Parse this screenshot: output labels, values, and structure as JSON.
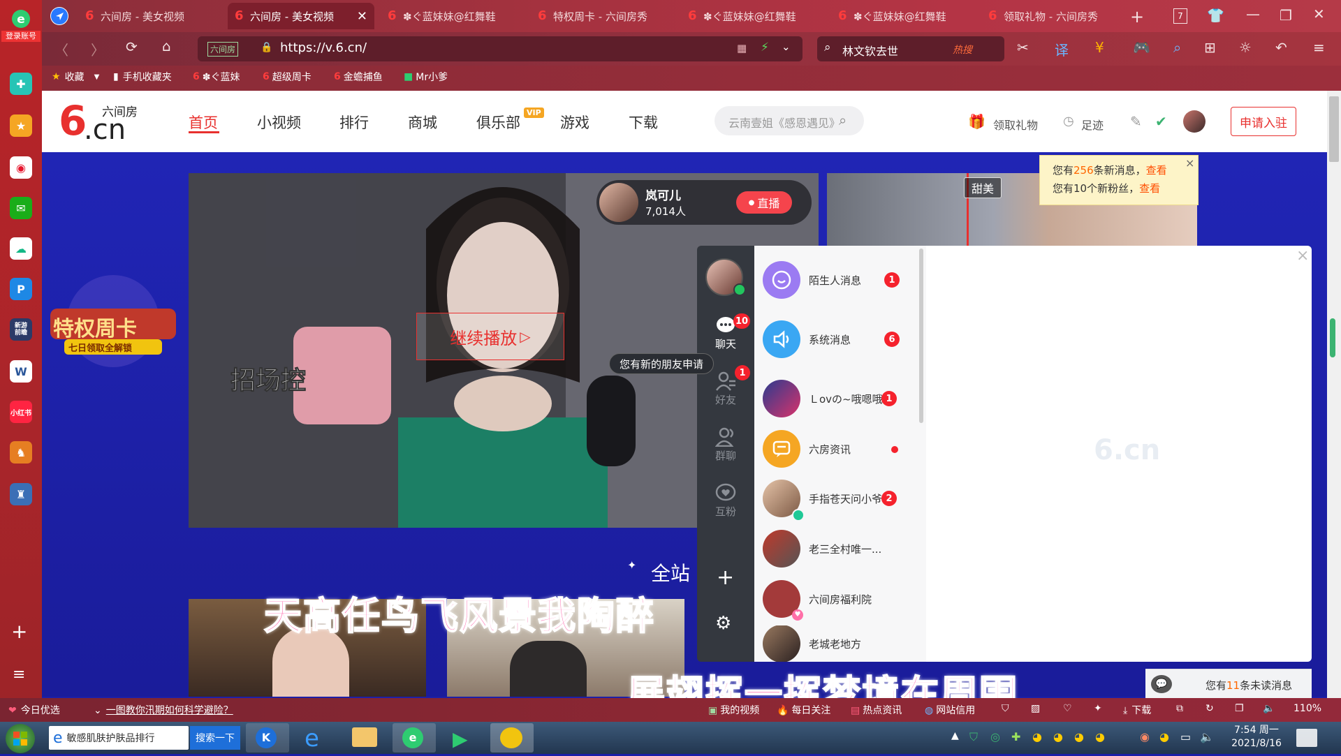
{
  "left_rail": {
    "login_label": "登录账号",
    "icons": [
      "green-plus-icon",
      "star-favorites-icon",
      "weibo-icon",
      "mail-icon",
      "cloud-icon",
      "p-icon",
      "game-news-icon",
      "word-doc-icon",
      "xiaohongshu-icon",
      "game-icon",
      "game2-icon"
    ],
    "xhs_label": "小红书",
    "news_label": "新游\n前瞻",
    "add_symbol": "+",
    "menu_symbol": "≡"
  },
  "tabs": [
    {
      "label": "六间房 - 美女视频",
      "active": false
    },
    {
      "label": "六间房 - 美女视频",
      "active": true
    },
    {
      "label": "✽ぐ蓝妹妹@红舞鞋",
      "active": false
    },
    {
      "label": "特权周卡 - 六间房秀",
      "active": false
    },
    {
      "label": "✽ぐ蓝妹妹@红舞鞋",
      "active": false
    },
    {
      "label": "✽ぐ蓝妹妹@红舞鞋",
      "active": false
    },
    {
      "label": "领取礼物 - 六间房秀",
      "active": false
    }
  ],
  "tab_count": "7",
  "address": {
    "url": "https://v.6.cn/",
    "site_tag": "六间房",
    "search_text": "林文钦去世",
    "hot_label": "热搜"
  },
  "bookmarks": [
    "收藏",
    "手机收藏夹",
    "✽ぐ蓝妹",
    "超级周卡",
    "金蟾捕鱼",
    "Mr小爹"
  ],
  "site": {
    "logo_text": ".cn",
    "logo_six": "6",
    "logo_sub": "六间房",
    "nav": [
      "首页",
      "小视频",
      "排行",
      "商城",
      "俱乐部",
      "游戏",
      "下载"
    ],
    "vip_badge": "VIP",
    "search_placeholder": "云南壹姐《感恩遇见》",
    "gift_label": "领取礼物",
    "footprint_label": "足迹",
    "apply_label": "申请入驻"
  },
  "notification": {
    "line1_prefix": "您有",
    "line1_num": "256",
    "line1_suffix": "条新消息，",
    "line1_link": "查看",
    "line2_prefix": "您有10个新粉丝，",
    "line2_link": "查看"
  },
  "stream": {
    "host_name": "岚可儿",
    "viewers": "7,014人",
    "live_label": "直播",
    "overlay_text": "招场控",
    "continue_label": "继续播放",
    "tag_label": "甜美",
    "banner_title": "特权周卡",
    "banner_sub": "七日领取全解锁",
    "section_title": "全站"
  },
  "message_panel": {
    "rail": [
      {
        "label": "聊天",
        "badge": "10",
        "active": true
      },
      {
        "label": "好友",
        "badge": "1",
        "active": false
      },
      {
        "label": "群聊",
        "badge": "",
        "active": false
      },
      {
        "label": "互粉",
        "badge": "",
        "active": false
      }
    ],
    "tooltip": "您有新的朋友申请",
    "items": [
      {
        "name": "陌生人消息",
        "badge": "1",
        "dot": false
      },
      {
        "name": "系统消息",
        "badge": "6",
        "dot": false
      },
      {
        "name": "Ｌovの~哦嗯哦",
        "badge": "1",
        "dot": false
      },
      {
        "name": "六房资讯",
        "badge": "",
        "dot": true
      },
      {
        "name": "手指苍天问小爷",
        "badge": "2",
        "dot": false
      },
      {
        "name": "老三全村唯一...",
        "badge": "",
        "dot": false
      },
      {
        "name": "六间房福利院",
        "badge": "",
        "dot": false
      },
      {
        "name": "老城老地方",
        "badge": "",
        "dot": false
      }
    ],
    "watermark": "6.cn",
    "unread_prefix": "您有",
    "unread_num": "11",
    "unread_suffix": "条未读消息",
    "close_symbol": "×"
  },
  "lyrics": {
    "line1": "天高任鸟飞风景我陶醉",
    "line2": "展翅挥一挥梦境在周围"
  },
  "statusbar": {
    "left_label": "今日优选",
    "news_link": "一图教你汛期如何科学避险？",
    "items": [
      "我的视频",
      "每日关注",
      "热点资讯",
      "网站信用"
    ],
    "download_label": "下载",
    "zoom": "110%"
  },
  "taskbar": {
    "ie_item": "敏感肌肤护肤品排行",
    "search_btn": "搜索一下",
    "time": "7:54 周一",
    "date": "2021/8/16"
  },
  "colors": {
    "brand_red": "#e8302e",
    "badge_red": "#f5222d",
    "content_blue": "#1c1fa8"
  }
}
